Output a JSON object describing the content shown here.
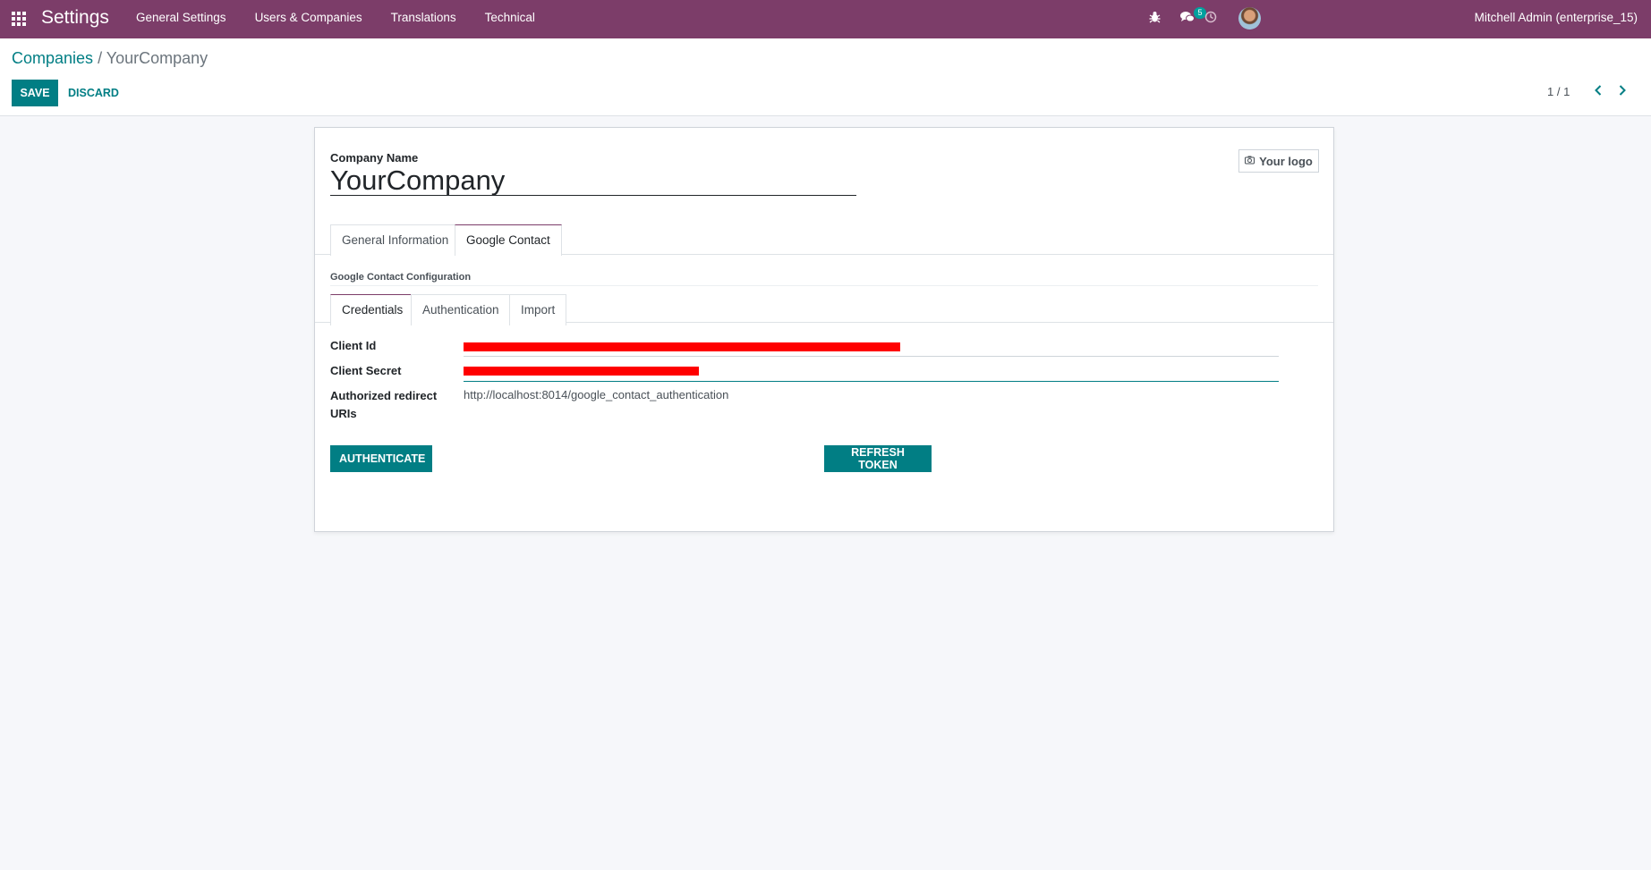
{
  "nav": {
    "brand": "Settings",
    "menu": [
      "General Settings",
      "Users & Companies",
      "Translations",
      "Technical"
    ],
    "chat_badge": "5",
    "user": "Mitchell Admin (enterprise_15)"
  },
  "breadcrumb": {
    "parent": "Companies",
    "separator": "/",
    "current": "YourCompany"
  },
  "actions": {
    "save": "SAVE",
    "discard": "DISCARD"
  },
  "pager": {
    "value": "1 / 1"
  },
  "form": {
    "company_name_label": "Company Name",
    "company_name": "YourCompany",
    "logo_button": "Your logo",
    "tabs": [
      "General Information",
      "Google Contact"
    ],
    "active_tab": "Google Contact",
    "section_title": "Google Contact Configuration",
    "sub_tabs": [
      "Credentials",
      "Authentication",
      "Import"
    ],
    "active_sub_tab": "Credentials",
    "fields": {
      "client_id_label": "Client Id",
      "client_secret_label": "Client Secret",
      "redirect_label": "Authorized redirect URIs",
      "redirect_value": "http://localhost:8014/google_contact_authentication"
    },
    "buttons": {
      "authenticate": "AUTHENTICATE",
      "refresh_token": "REFRESH TOKEN"
    }
  },
  "colors": {
    "navbar": "#7c3d69",
    "primary": "#017e84",
    "redaction": "#ff0000"
  }
}
